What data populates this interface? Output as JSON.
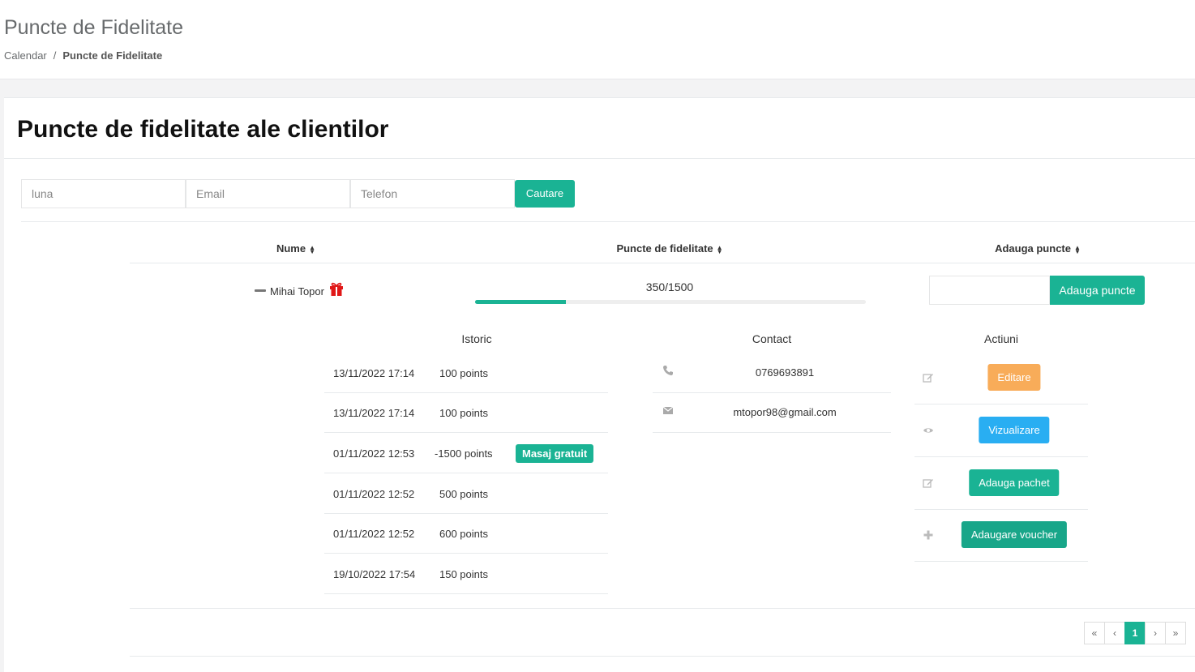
{
  "header": {
    "title": "Puncte de Fidelitate",
    "breadcrumb": {
      "parent": "Calendar",
      "separator": "/",
      "current": "Puncte de Fidelitate"
    }
  },
  "card": {
    "title": "Puncte de fidelitate ale clientilor"
  },
  "filters": {
    "month_placeholder": "luna",
    "email_placeholder": "Email",
    "phone_placeholder": "Telefon",
    "search_label": "Cautare"
  },
  "table": {
    "columns": [
      "Nume",
      "Puncte de fidelitate",
      "Adauga puncte"
    ],
    "client": {
      "name": "Mihai Topor",
      "points_text": "350/1500",
      "points_fraction": 0.2333,
      "add_button": "Adauga puncte"
    }
  },
  "details": {
    "history_title": "Istoric",
    "contact_title": "Contact",
    "actions_title": "Actiuni",
    "history": [
      {
        "date": "13/11/2022 17:14",
        "points": "100 points",
        "badge": ""
      },
      {
        "date": "13/11/2022 17:14",
        "points": "100 points",
        "badge": ""
      },
      {
        "date": "01/11/2022 12:53",
        "points": "-1500 points",
        "badge": "Masaj gratuit"
      },
      {
        "date": "01/11/2022 12:52",
        "points": "500 points",
        "badge": ""
      },
      {
        "date": "01/11/2022 12:52",
        "points": "600 points",
        "badge": ""
      },
      {
        "date": "19/10/2022 17:54",
        "points": "150 points",
        "badge": ""
      }
    ],
    "contact": {
      "phone": "0769693891",
      "email": "mtopor98@gmail.com"
    },
    "actions": {
      "edit": "Editare",
      "view": "Vizualizare",
      "add_package": "Adauga pachet",
      "add_voucher": "Adaugare voucher"
    }
  },
  "pagination": {
    "first": "«",
    "prev": "‹",
    "current": "1",
    "next": "›",
    "last": "»"
  },
  "colors": {
    "primary": "#1ab394",
    "warning": "#f8ac59",
    "info": "#29aef2",
    "gift": "#e01818"
  }
}
